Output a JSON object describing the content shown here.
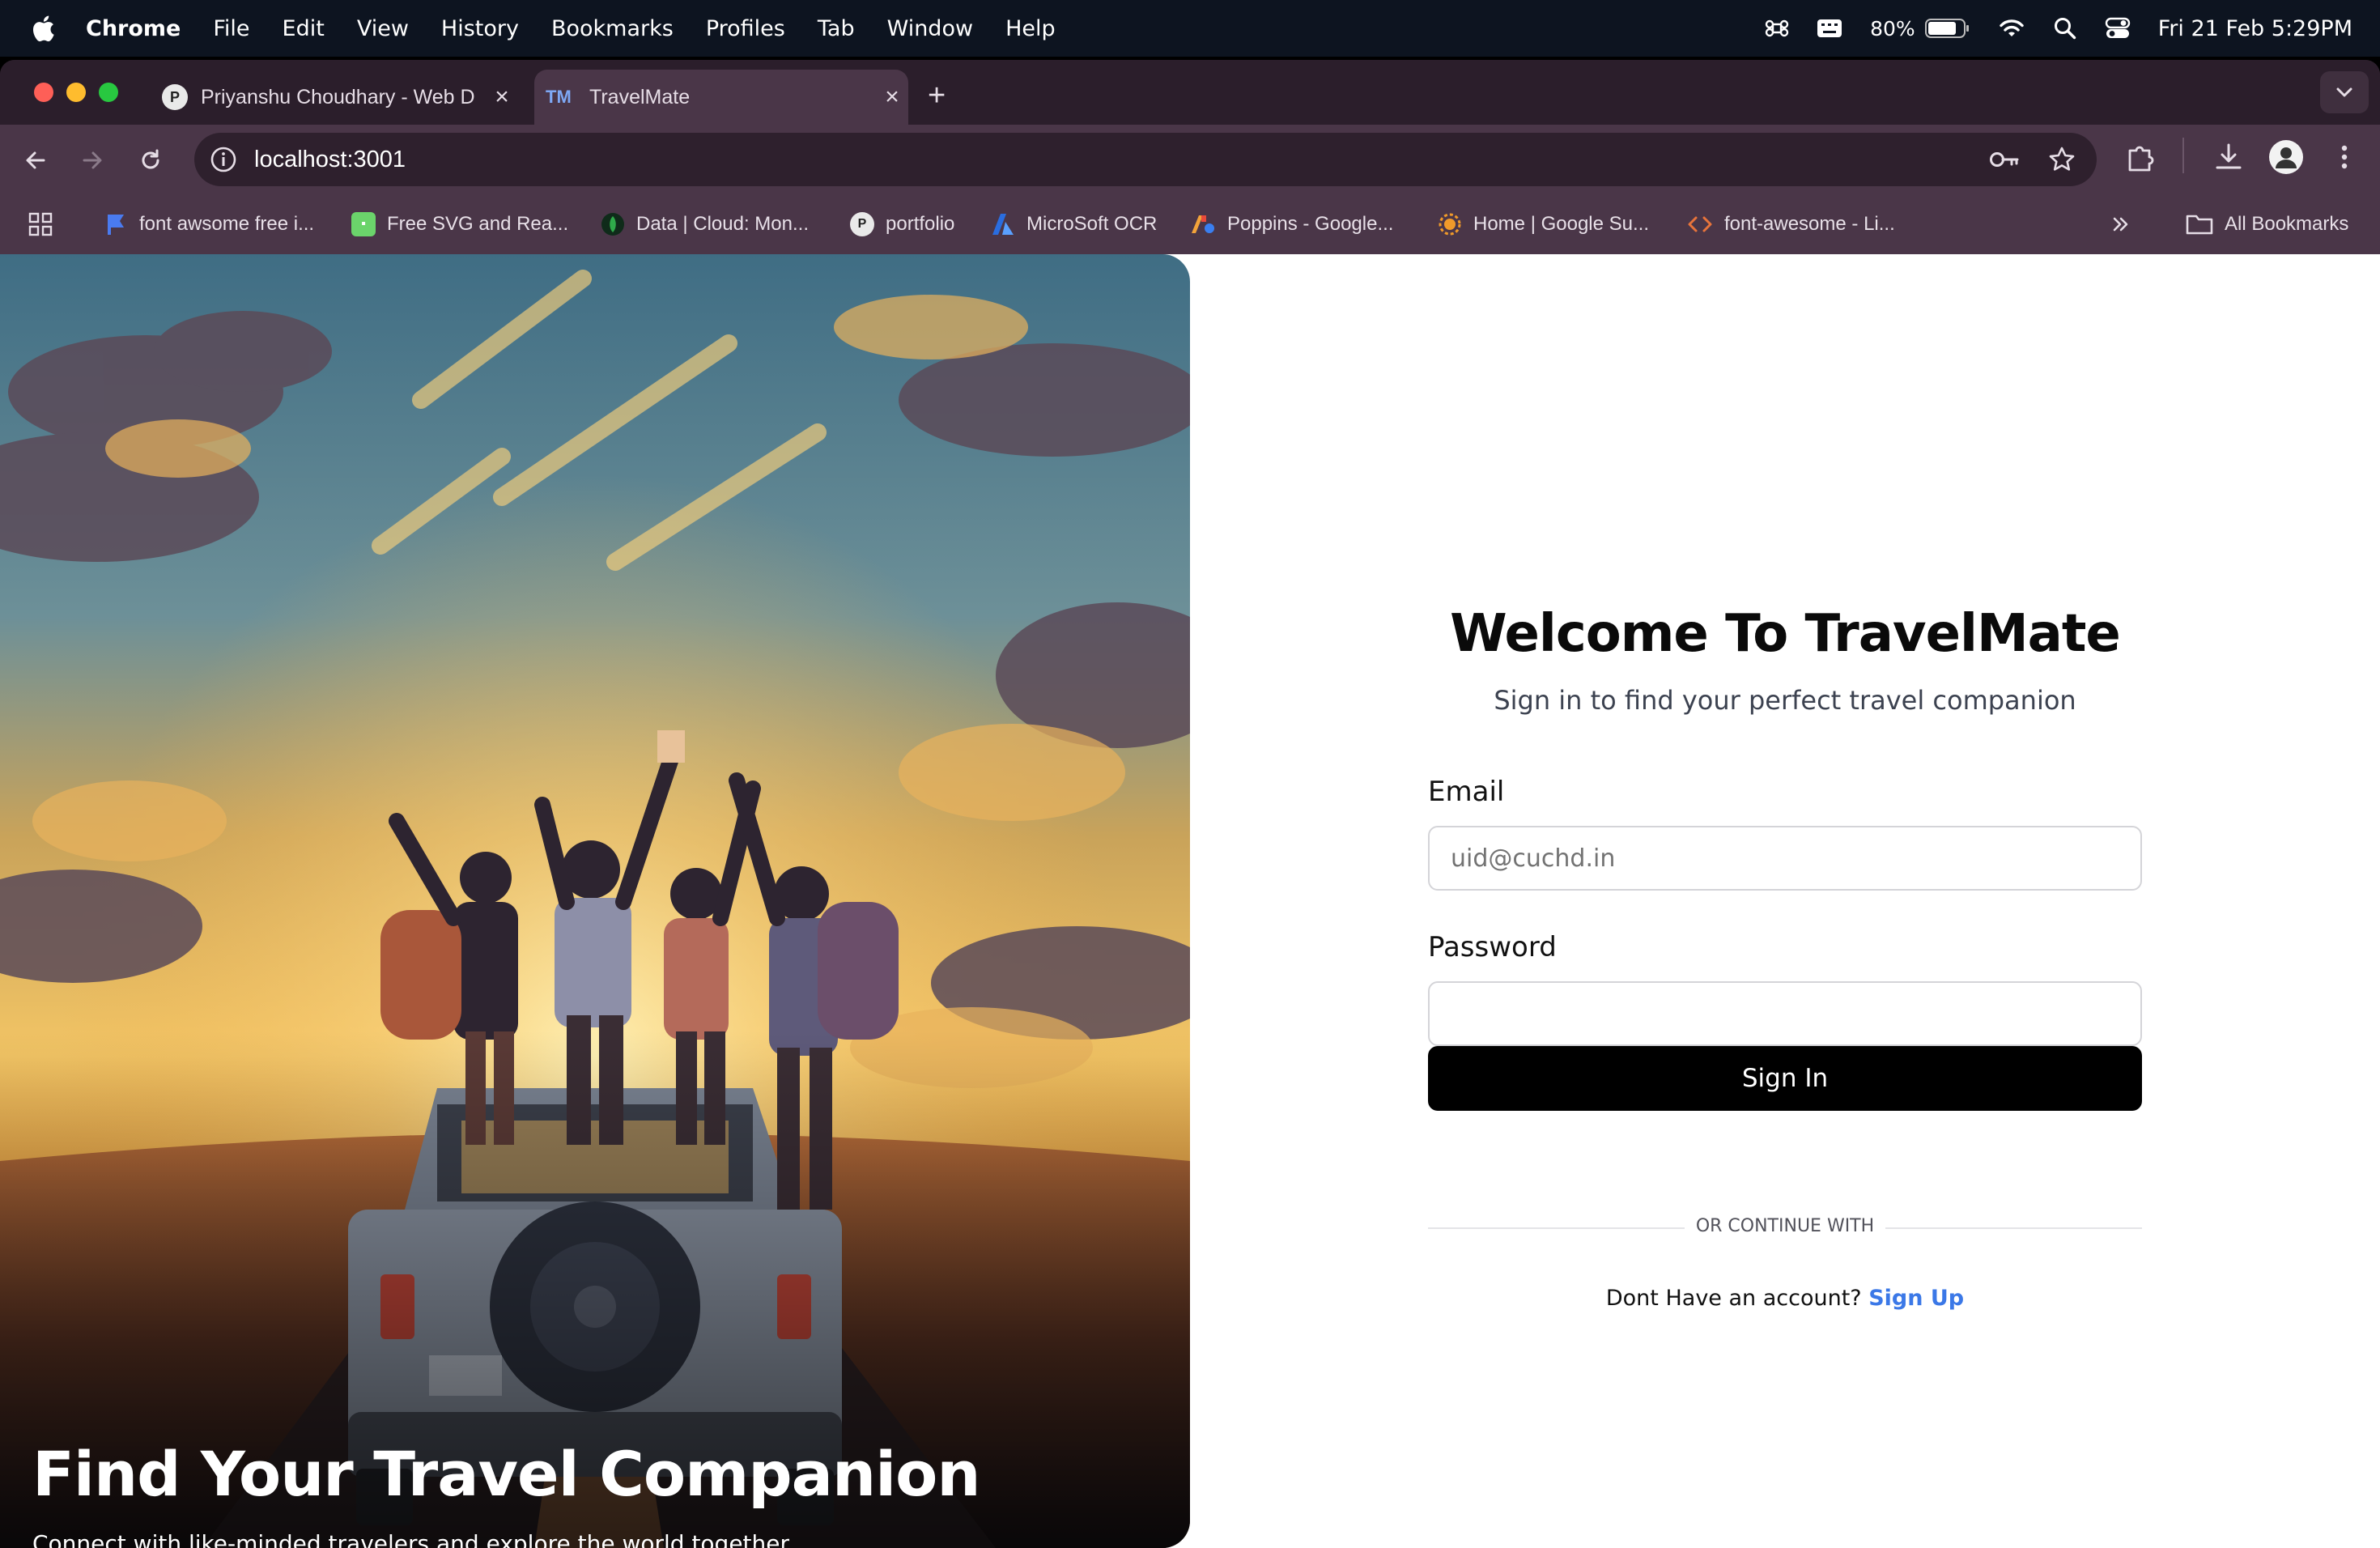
{
  "menubar": {
    "app_name": "Chrome",
    "menus": [
      "File",
      "Edit",
      "View",
      "History",
      "Bookmarks",
      "Profiles",
      "Tab",
      "Window",
      "Help"
    ],
    "battery": "80%",
    "datetime": "Fri 21 Feb  5:29PM"
  },
  "tabs": [
    {
      "title": "Priyanshu Choudhary - Web D",
      "active": false,
      "icon": "avatar-icon"
    },
    {
      "title": "TravelMate",
      "active": true,
      "favicon_text": "TM"
    }
  ],
  "toolbar": {
    "url": "localhost:3001"
  },
  "bookmarks": [
    {
      "label": "font awsome free i...",
      "icon": "flag-icon",
      "color": "#4a7bf0"
    },
    {
      "label": "Free SVG and Rea...",
      "icon": "svg-icon",
      "color": "#6bd46b"
    },
    {
      "label": "Data | Cloud: Mon...",
      "icon": "leaf-icon",
      "color": "#1b7d3a"
    },
    {
      "label": "portfolio",
      "icon": "avatar-icon",
      "color": "#e9e9e9"
    },
    {
      "label": "MicroSoft OCR",
      "icon": "azure-icon",
      "color": "#3a7ff0"
    },
    {
      "label": "Poppins - Google...",
      "icon": "google-fonts-icon",
      "color": "#f2a33a"
    },
    {
      "label": "Home | Google Su...",
      "icon": "sun-icon",
      "color": "#f09a2a"
    },
    {
      "label": "font-awesome - Li...",
      "icon": "code-icon",
      "color": "#e8743b"
    }
  ],
  "bookmarks_all": "All Bookmarks",
  "hero": {
    "title": "Find Your Travel Companion",
    "subtitle": "Connect with like-minded travelers and explore the world together."
  },
  "login": {
    "heading": "Welcome To TravelMate",
    "subheading": "Sign in to find your perfect travel companion",
    "email_label": "Email",
    "email_placeholder": "uid@cuchd.in",
    "email_value": "",
    "password_label": "Password",
    "password_value": "",
    "submit_label": "Sign In",
    "divider": "OR CONTINUE WITH",
    "no_account": "Dont Have an account?",
    "signup_label": "Sign Up"
  },
  "colors": {
    "menubar_bg": "#0d1420",
    "browser_chrome": "#4a3648",
    "primary_button": "#000000",
    "link": "#3b78e7"
  }
}
